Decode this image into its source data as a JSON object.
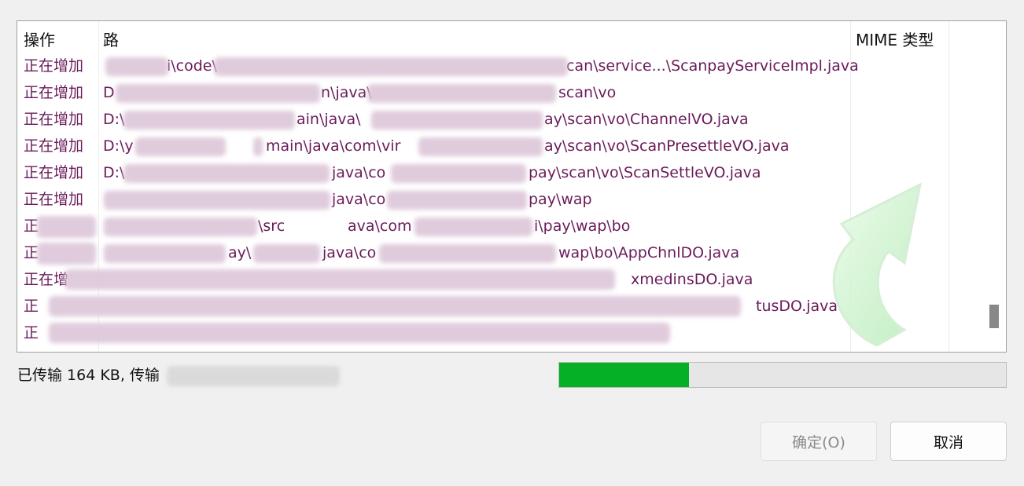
{
  "table": {
    "headers": {
      "operation": "操作",
      "path": "路",
      "mime": "MIME 类型"
    },
    "rows": [
      {
        "operation": "正在增加",
        "path_start": "",
        "path_end": "i\\code\\",
        "path_tail": "can\\service...\\ScanpayServiceImpl.java"
      },
      {
        "operation": "正在增加",
        "path_start": "D",
        "path_end": "n\\java\\",
        "path_tail": "scan\\vo"
      },
      {
        "operation": "正在增加",
        "path_start": "D:\\",
        "path_end": "ain\\java\\",
        "path_tail": "ay\\scan\\vo\\ChannelVO.java"
      },
      {
        "operation": "正在增加",
        "path_start": "D:\\y",
        "path_end": "main\\java\\com\\vir",
        "path_tail": "ay\\scan\\vo\\ScanPresettleVO.java"
      },
      {
        "operation": "正在增加",
        "path_start": "D:\\",
        "path_end": "java\\co",
        "path_tail": "pay\\scan\\vo\\ScanSettleVO.java"
      },
      {
        "operation": "正在增加",
        "path_start": "",
        "path_end": "java\\co",
        "path_tail": "pay\\wap"
      },
      {
        "operation": "正",
        "path_start": "",
        "path_end": "\\src",
        "path_tail": "ava\\com",
        "path_tail2": "i\\pay\\wap\\bo"
      },
      {
        "operation": "正",
        "path_start": "",
        "path_end": "ay\\",
        "path_tail": "java\\co",
        "path_tail2": "wap\\bo\\AppChnlDO.java"
      },
      {
        "operation": "正在增",
        "path_start": "",
        "path_end": "",
        "path_tail": "xmedinsDO.java"
      },
      {
        "operation": "正",
        "path_start": "",
        "path_end": "",
        "path_tail": "tusDO.java"
      },
      {
        "operation": "正",
        "path_start": "",
        "path_end": "",
        "path_tail": ""
      }
    ]
  },
  "status": {
    "text": "已传输 164 KB, 传输"
  },
  "progress": {
    "percent": 29
  },
  "buttons": {
    "ok": "确定(O)",
    "cancel": "取消"
  },
  "colors": {
    "row_text": "#6a1b5a",
    "progress_fill": "#06b025"
  }
}
